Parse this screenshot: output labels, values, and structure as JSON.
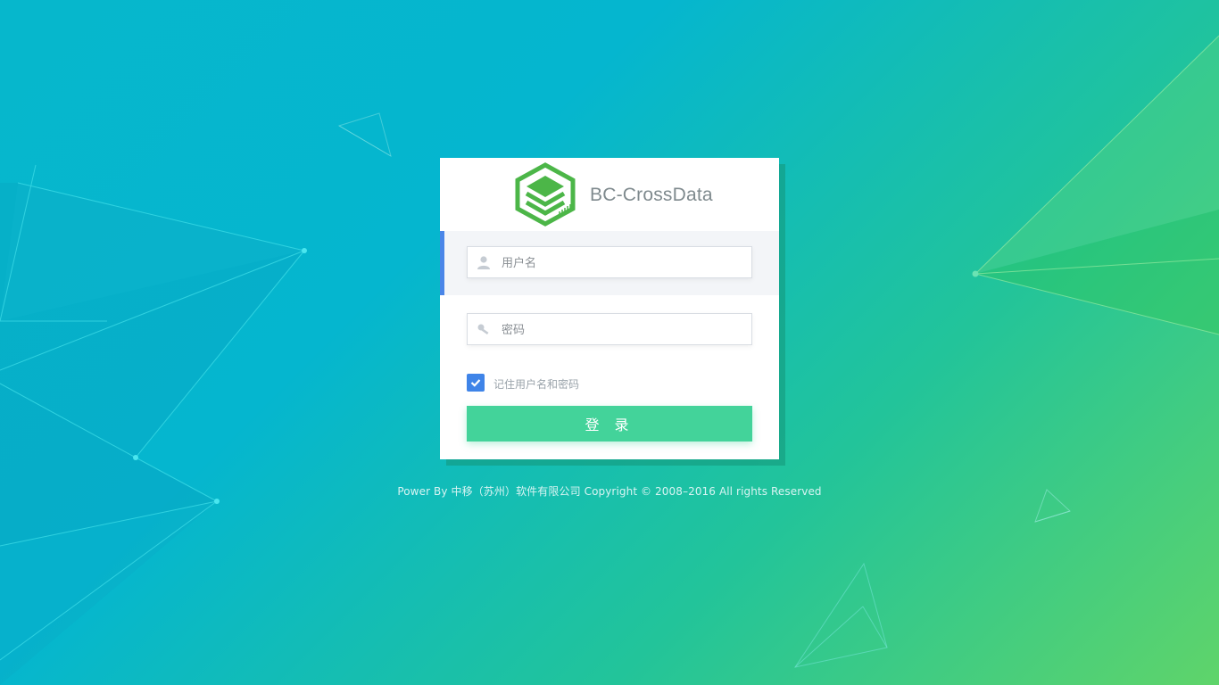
{
  "brand": {
    "name": "BC-CrossData",
    "logo_icon": "stacked-layers-hexagon-icon",
    "logo_color": "#4cb648"
  },
  "form": {
    "username": {
      "placeholder": "用户名",
      "value": "",
      "icon": "user-icon"
    },
    "password": {
      "placeholder": "密码",
      "value": "",
      "icon": "key-icon"
    },
    "remember": {
      "label": "记住用户名和密码",
      "checked": true
    },
    "submit_label": "登 录"
  },
  "footer": {
    "text": "Power By 中移（苏州）软件有限公司  Copyright © 2008–2016 All rights Reserved"
  },
  "colors": {
    "accent": "#4a86e8",
    "button": "#43d39a",
    "checkbox": "#3f84e8"
  }
}
